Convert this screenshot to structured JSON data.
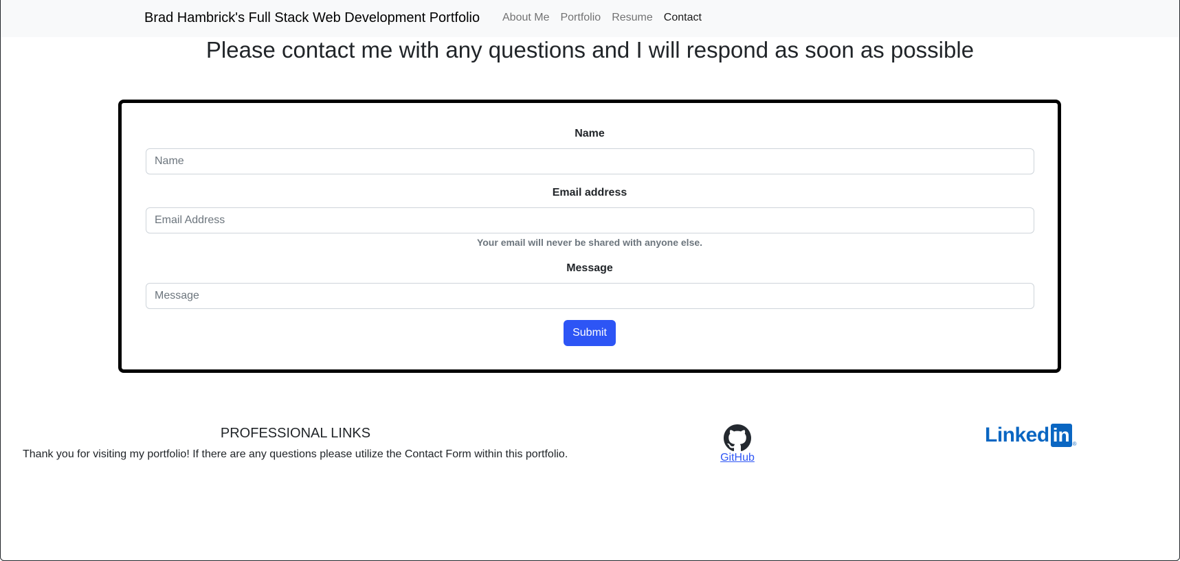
{
  "navbar": {
    "brand": "Brad Hambrick's Full Stack Web Development Portfolio",
    "links": [
      {
        "label": "About Me",
        "active": false
      },
      {
        "label": "Portfolio",
        "active": false
      },
      {
        "label": "Resume",
        "active": false
      },
      {
        "label": "Contact",
        "active": true
      }
    ]
  },
  "main": {
    "heading": "Please contact me with any questions and I will respond as soon as possible"
  },
  "form": {
    "name_label": "Name",
    "name_placeholder": "Name",
    "email_label": "Email address",
    "email_placeholder": "Email Address",
    "email_help": "Your email will never be shared with anyone else.",
    "message_label": "Message",
    "message_placeholder": "Message",
    "submit_label": "Submit"
  },
  "footer": {
    "heading": "PROFESSIONAL LINKS",
    "text": "Thank you for visiting my portfolio! If there are any questions please utilize the Contact Form within this portfolio.",
    "github_label": "GitHub",
    "linkedin_word": "Linked",
    "linkedin_box": "in",
    "linkedin_mark": "®"
  },
  "colors": {
    "navbar_bg": "#f8f9fa",
    "primary": "#2d55f5",
    "linkedin_blue": "#0a66c2",
    "card_border": "#000000"
  },
  "icons": [
    "github-icon",
    "linkedin-logo"
  ]
}
